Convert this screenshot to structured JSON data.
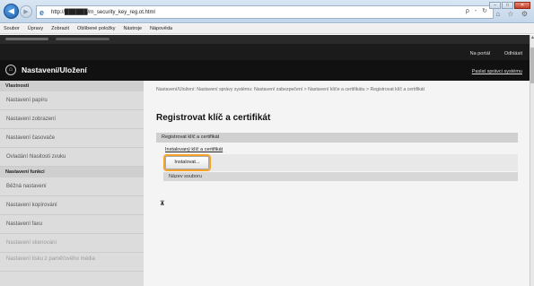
{
  "browser": {
    "url": "http://██████/rn_security_key_reg.ot.html",
    "address_icons": "ρ ‑ ↻",
    "tools_icons": "⌂ ☆ ⚙",
    "menu": [
      "Soubor",
      "Úpravy",
      "Zobrazit",
      "Oblíbené položky",
      "Nástroje",
      "Nápověda"
    ]
  },
  "header": {
    "portal_link": "Na portál",
    "logout_link": "Odhlásit",
    "app_title": "Nastavení/Uložení",
    "admin_link": "Paslat správci systému"
  },
  "sidebar": {
    "section1": "Vlastnosti",
    "items1": [
      "Nastavení papíru",
      "Nastavení zobrazení",
      "Nastavení časovače",
      "Ovladání hlasitosti zvuku"
    ],
    "section2": "Nastavení funkcí",
    "items2": [
      "Běžná nastavení",
      "Nastavení kopírování",
      "Nastavení faxu",
      "Nastavení skenování",
      "Nastavení tisku z paměťového média"
    ]
  },
  "main": {
    "breadcrumb": "Nastavení/Uložení: Nastavení správy systému: Nastavení zabezpečení > Nastavení klíče a certifikátu > Registrovat klíč a certifikát",
    "title": "Registrovat klíč a certifikát",
    "section_label": "Registrovat klíč a certifikát",
    "field_label": "Instalovaný klíč a certifikát",
    "install_button": "Instalovat...",
    "column_header": "Název souboru",
    "top_icon": "⊼"
  }
}
